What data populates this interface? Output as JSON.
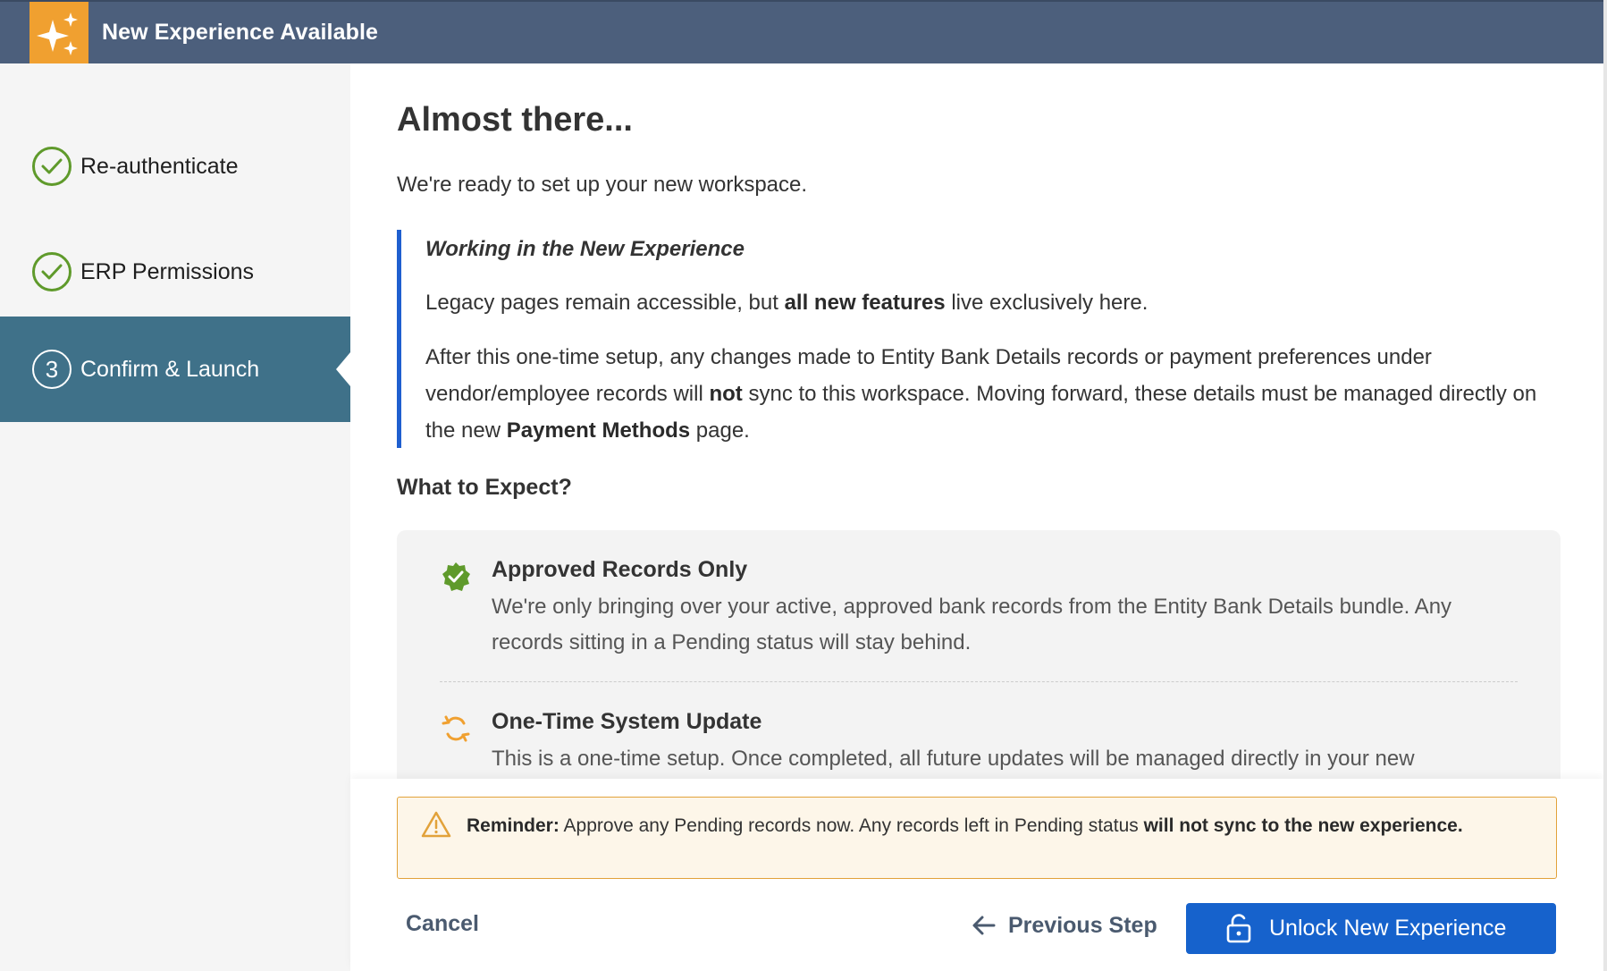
{
  "header": {
    "title": "New Experience Available",
    "badge_icon": "sparkles-icon",
    "badge_color": "#f0a030",
    "bg_color": "#4c5f7c"
  },
  "sidebar": {
    "steps": [
      {
        "label": "Re-authenticate",
        "status": "done",
        "icon": "check-circle-icon"
      },
      {
        "label": "ERP Permissions",
        "status": "done",
        "icon": "check-circle-icon"
      },
      {
        "label": "Confirm & Launch",
        "status": "active",
        "number": "3"
      }
    ]
  },
  "main": {
    "title": "Almost there...",
    "intro": "We're ready to set up your new workspace.",
    "callout": {
      "title": "Working in the New Experience",
      "p1": {
        "pre": "Legacy pages remain accessible, but ",
        "bold": "all new features",
        "post": " live exclusively here."
      },
      "p2": {
        "part1": "After this one-time setup, any changes made to Entity Bank Details records or payment preferences under vendor/employee records will ",
        "bold1": "not",
        "part2": " sync to this workspace. Moving forward, these details must be managed directly on the new ",
        "bold2": "Payment Methods",
        "part3": " page."
      }
    },
    "expect_title": "What to Expect?",
    "expect_items": [
      {
        "icon": "verified-badge-icon",
        "title": "Approved Records Only",
        "desc": "We're only bringing over your active, approved bank records from the Entity Bank Details bundle. Any records sitting in a Pending status will stay behind."
      },
      {
        "icon": "sync-icon",
        "title": "One-Time System Update",
        "desc": "This is a one-time setup. Once completed, all future updates will be managed directly in your new"
      }
    ]
  },
  "footer": {
    "reminder": {
      "label": "Reminder:",
      "text": " Approve any Pending records now. Any records left in Pending status ",
      "bold": "will not sync to the new experience."
    },
    "cancel": "Cancel",
    "previous": "Previous Step",
    "unlock": "Unlock New Experience",
    "primary_color": "#1662cc"
  }
}
